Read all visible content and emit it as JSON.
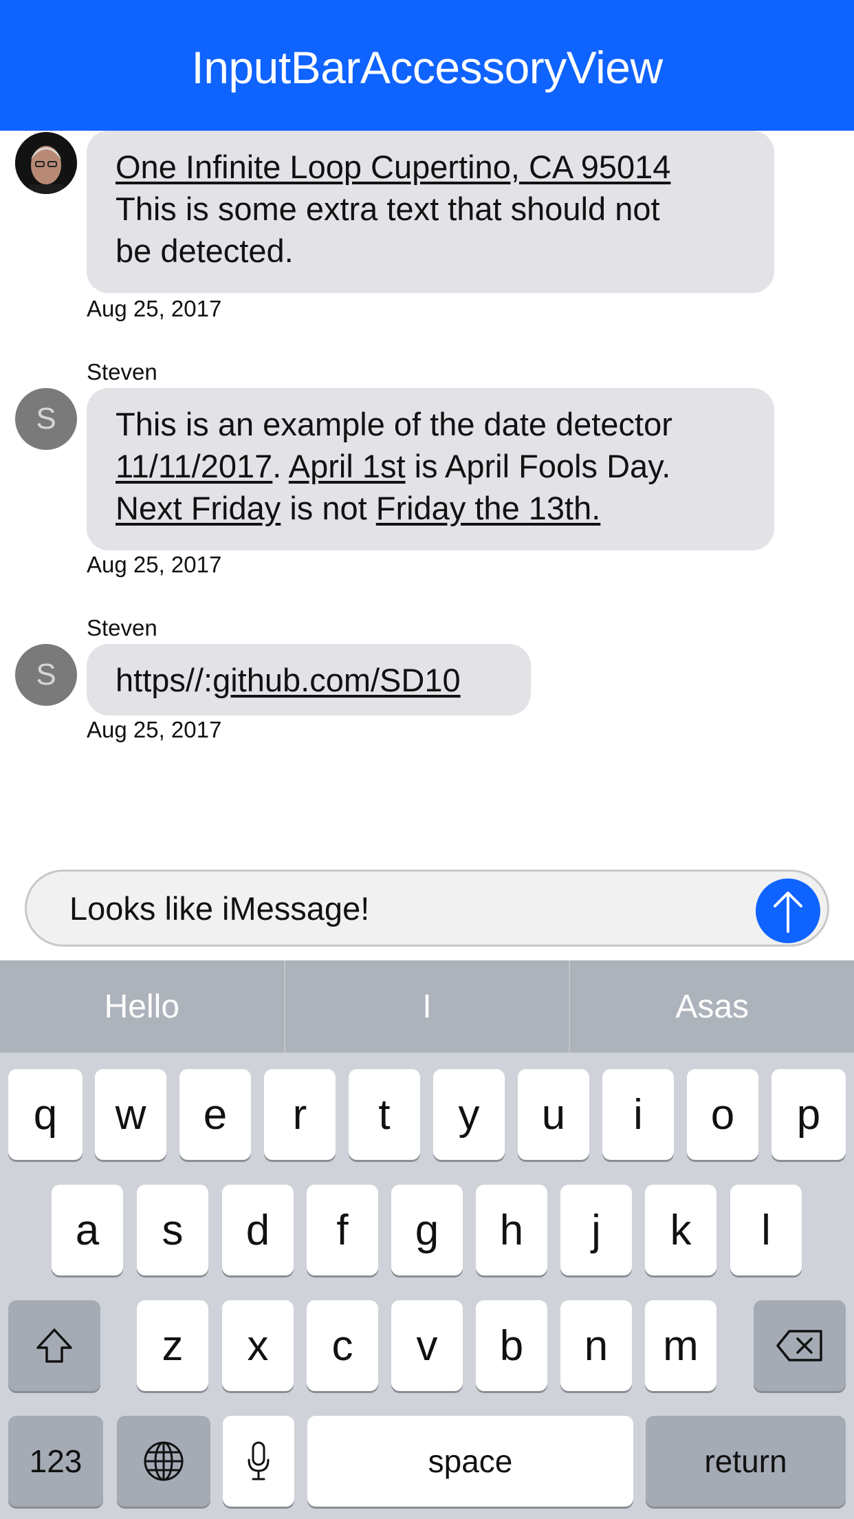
{
  "nav": {
    "title": "InputBarAccessoryView"
  },
  "colors": {
    "accent": "#0f63ff",
    "bubble": "#e2e2e7",
    "keyboard": "#cfd2d8"
  },
  "messages": [
    {
      "sender": "",
      "avatar": "photo",
      "lines": [
        [
          {
            "text": "One Infinite Loop Cupertino, CA 95014",
            "link": true
          }
        ],
        [
          {
            "text": "This is some extra text that should not",
            "link": false
          }
        ],
        [
          {
            "text": "be detected.",
            "link": false
          }
        ]
      ],
      "date": "Aug 25, 2017"
    },
    {
      "sender": "Steven",
      "avatar_initial": "S",
      "lines": [
        [
          {
            "text": "This is an example of the date detector",
            "link": false
          }
        ],
        [
          {
            "text": "11/11/2017",
            "link": true
          },
          {
            "text": ". ",
            "link": false
          },
          {
            "text": "April 1st",
            "link": true
          },
          {
            "text": " is April Fools Day.",
            "link": false
          }
        ],
        [
          {
            "text": "Next Friday",
            "link": true
          },
          {
            "text": " is not ",
            "link": false
          },
          {
            "text": "Friday the 13th.",
            "link": true
          }
        ]
      ],
      "date": "Aug 25, 2017"
    },
    {
      "sender": "Steven",
      "avatar_initial": "S",
      "lines": [
        [
          {
            "text": "https//:",
            "link": false
          },
          {
            "text": "github.com/SD10",
            "link": true
          }
        ]
      ],
      "date": "Aug 25, 2017"
    }
  ],
  "input": {
    "value": "Looks like iMessage!",
    "send_icon": "arrow-up-icon"
  },
  "keyboard": {
    "suggestions": [
      "Hello",
      "I",
      "Asas"
    ],
    "row1": [
      "q",
      "w",
      "e",
      "r",
      "t",
      "y",
      "u",
      "i",
      "o",
      "p"
    ],
    "row2": [
      "a",
      "s",
      "d",
      "f",
      "g",
      "h",
      "j",
      "k",
      "l"
    ],
    "row3": [
      "z",
      "x",
      "c",
      "v",
      "b",
      "n",
      "m"
    ],
    "numbers_label": "123",
    "space_label": "space",
    "return_label": "return",
    "shift_icon": "shift-icon",
    "delete_icon": "backspace-icon",
    "globe_icon": "globe-icon",
    "mic_icon": "microphone-icon"
  }
}
